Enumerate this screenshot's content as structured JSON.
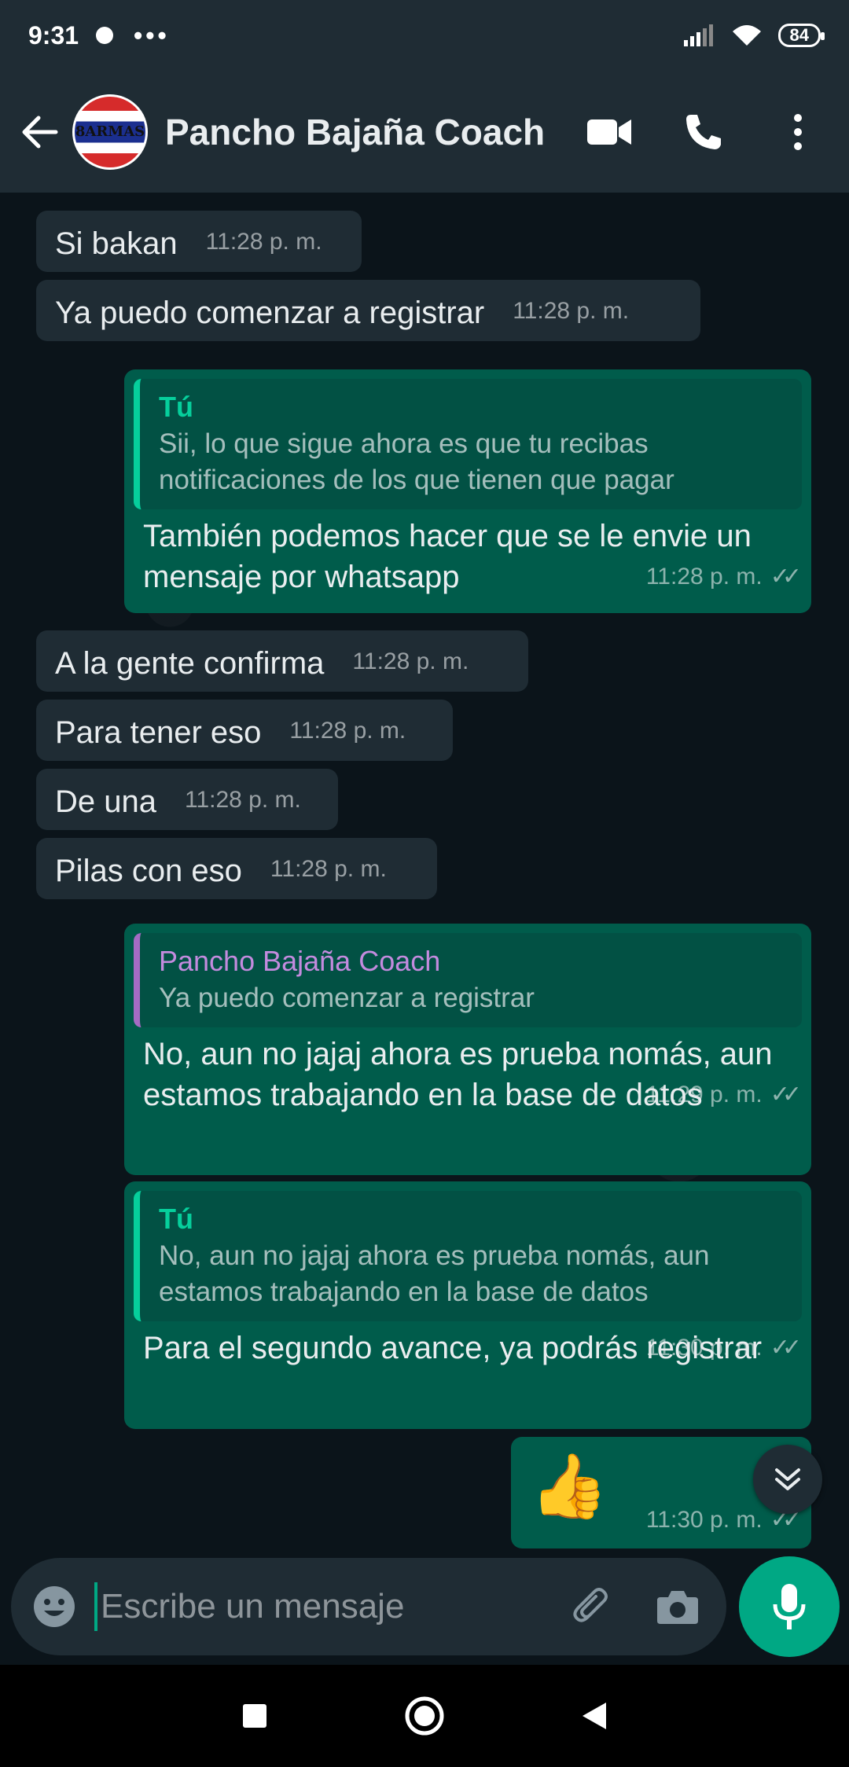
{
  "status_bar": {
    "time": "9:31",
    "more": "•••",
    "battery": "84"
  },
  "header": {
    "avatar_text": "8ARMAS",
    "contact_name": "Pancho Bajaña Coach"
  },
  "messages": [
    {
      "text": "Si bakan",
      "time": "11:28 p. m."
    },
    {
      "text": "Ya puedo comenzar a registrar",
      "time": "11:28 p. m."
    },
    {
      "quote_author": "Tú",
      "quote_text": "Sii, lo que sigue ahora es que tu recibas notificaciones de los que tienen que pagar",
      "text": "También podemos hacer que se le envie un mensaje por whatsapp",
      "time": "11:28 p. m."
    },
    {
      "text": "A la gente confirma",
      "time": "11:28 p. m."
    },
    {
      "text": "Para tener eso",
      "time": "11:28 p. m."
    },
    {
      "text": "De una",
      "time": "11:28 p. m."
    },
    {
      "text": "Pilas con eso",
      "time": "11:28 p. m."
    },
    {
      "quote_author": "Pancho Bajaña Coach",
      "quote_text": "Ya puedo comenzar a registrar",
      "text": "No, aun no jajaj ahora es prueba nomás, aun estamos trabajando en la base de datos",
      "time": "11:29 p. m."
    },
    {
      "quote_author": "Tú",
      "quote_text": "No, aun no jajaj ahora es prueba nomás, aun estamos trabajando en la base de datos",
      "text": "Para el segundo avance, ya podrás registrar",
      "time": "11:30 p. m."
    },
    {
      "text": "👍",
      "time": "11:30 p. m."
    }
  ],
  "composer": {
    "placeholder": "Escribe un mensaje"
  },
  "colors": {
    "incoming": "#1f2c34",
    "outgoing": "#005c4b",
    "accent": "#00a884"
  }
}
